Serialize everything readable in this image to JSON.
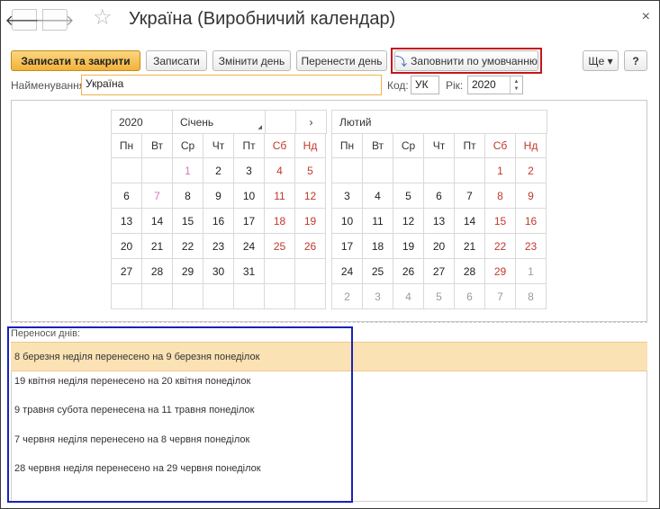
{
  "window": {
    "title": "Україна (Виробничий календар)",
    "back": "🡐",
    "forward": "🡒",
    "star": "☆",
    "close": "×"
  },
  "toolbar": {
    "save_close": "Записати та закрити",
    "save": "Записати",
    "change_day": "Змінити день",
    "move_day": "Перенести день",
    "fill_default": "Заповнити по умовчанню",
    "more": "Ще ▾",
    "help": "?"
  },
  "form": {
    "name_label": "Найменування:",
    "name_value": "Україна",
    "code_label": "Код:",
    "code_value": "УК",
    "year_label": "Рік:",
    "year_value": "2020"
  },
  "calendar": {
    "year": "2020",
    "jan_name": "Січень",
    "feb_name": "Лютий",
    "next": "›",
    "weekdays": [
      "Пн",
      "Вт",
      "Ср",
      "Чт",
      "Пт",
      "Сб",
      "Нд"
    ],
    "january": [
      [
        "",
        "",
        "1",
        "2",
        "3",
        "4",
        "5"
      ],
      [
        "6",
        "7",
        "8",
        "9",
        "10",
        "11",
        "12"
      ],
      [
        "13",
        "14",
        "15",
        "16",
        "17",
        "18",
        "19"
      ],
      [
        "20",
        "21",
        "22",
        "23",
        "24",
        "25",
        "26"
      ],
      [
        "27",
        "28",
        "29",
        "30",
        "31",
        "",
        ""
      ],
      [
        "",
        "",
        "",
        "",
        "",
        "",
        ""
      ]
    ],
    "february": [
      [
        "",
        "",
        "",
        "",
        "",
        "1",
        "2"
      ],
      [
        "3",
        "4",
        "5",
        "6",
        "7",
        "8",
        "9"
      ],
      [
        "10",
        "11",
        "12",
        "13",
        "14",
        "15",
        "16"
      ],
      [
        "17",
        "18",
        "19",
        "20",
        "21",
        "22",
        "23"
      ],
      [
        "24",
        "25",
        "26",
        "27",
        "28",
        "29",
        "1"
      ],
      [
        "2",
        "3",
        "4",
        "5",
        "6",
        "7",
        "8"
      ]
    ]
  },
  "transfers": {
    "label": "Переноси днів:",
    "items": [
      "8 березня неділя перенесено на 9 березня понеділок",
      "19 квітня неділя перенесено на 20 квітня понеділок",
      "9 травня субота перенесена на 11 травня понеділок",
      "7 червня неділя перенесено на 8 червня понеділок",
      "28 червня неділя перенесено на 29 червня понеділок"
    ]
  },
  "colors": {
    "primary_button": "#f2b23a",
    "weekend": "#c0392b",
    "selected_row": "#fbe2b4",
    "highlight_red": "#c4161c",
    "highlight_blue": "#1a22b8"
  }
}
